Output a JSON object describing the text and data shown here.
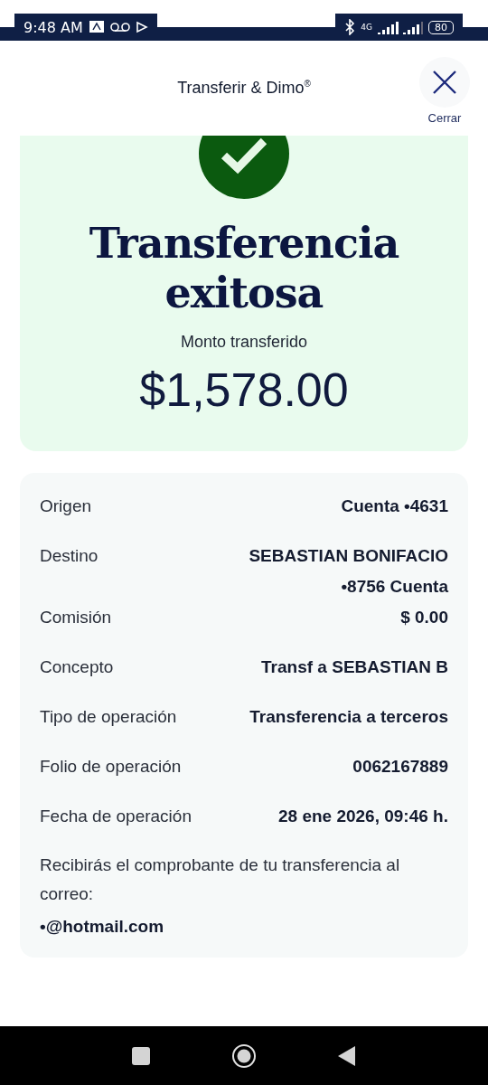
{
  "status_bar": {
    "time": "9:48 AM",
    "network": "4G",
    "battery": "80"
  },
  "header": {
    "title": "Transferir & Dimo$^{®}$",
    "close_label": "Cerrar"
  },
  "success": {
    "title": "Transferencia exitosa",
    "amount_label": "Monto transferido",
    "amount": "$1,578.00"
  },
  "details": [
    {
      "label": "Origen",
      "value": [
        "Cuenta •4631"
      ]
    },
    {
      "label": "Destino",
      "value": [
        "SEBASTIAN BONIFACIO",
        "•8756 Cuenta"
      ]
    },
    {
      "label": "Comisión",
      "value": [
        "$ 0.00"
      ]
    },
    {
      "label": "Concepto",
      "value": [
        "Transf a SEBASTIAN B"
      ]
    },
    {
      "label": "Tipo de operación",
      "value": [
        "Transferencia a terceros"
      ]
    },
    {
      "label": "Folio de operación",
      "value": [
        "0062167889"
      ]
    },
    {
      "label": "Fecha de operación",
      "value": [
        "28 ene 2026, 09:46 h."
      ]
    }
  ],
  "receipt_note": "Recibirás el comprobante de tu transferencia al correo:",
  "email": "•@hotmail.com"
}
